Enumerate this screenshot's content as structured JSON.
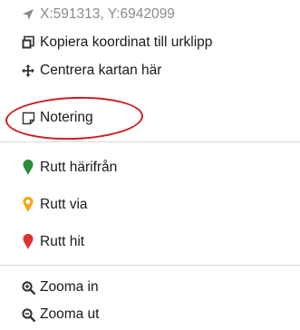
{
  "menu": {
    "coordinates": "X:591313, Y:6942099",
    "copy_coordinate": "Kopiera koordinat till urklipp",
    "center_map": "Centrera kartan här",
    "note": "Notering",
    "route_from": "Rutt härifrån",
    "route_via": "Rutt via",
    "route_to": "Rutt hit",
    "zoom_in": "Zooma in",
    "zoom_out": "Zooma ut"
  },
  "icons": {
    "coordinates": "location-arrow-icon",
    "copy": "copy-icon",
    "center": "move-arrows-icon",
    "note": "note-icon",
    "route_from": "map-pin-icon",
    "route_via": "map-pin-icon",
    "route_to": "map-pin-icon",
    "zoom_in": "zoom-in-icon",
    "zoom_out": "zoom-out-icon"
  },
  "colors": {
    "route_from_pin": "#2e8b3a",
    "route_via_pin": "#f0a818",
    "route_to_pin": "#e03131",
    "highlight_circle": "#d0181f"
  }
}
